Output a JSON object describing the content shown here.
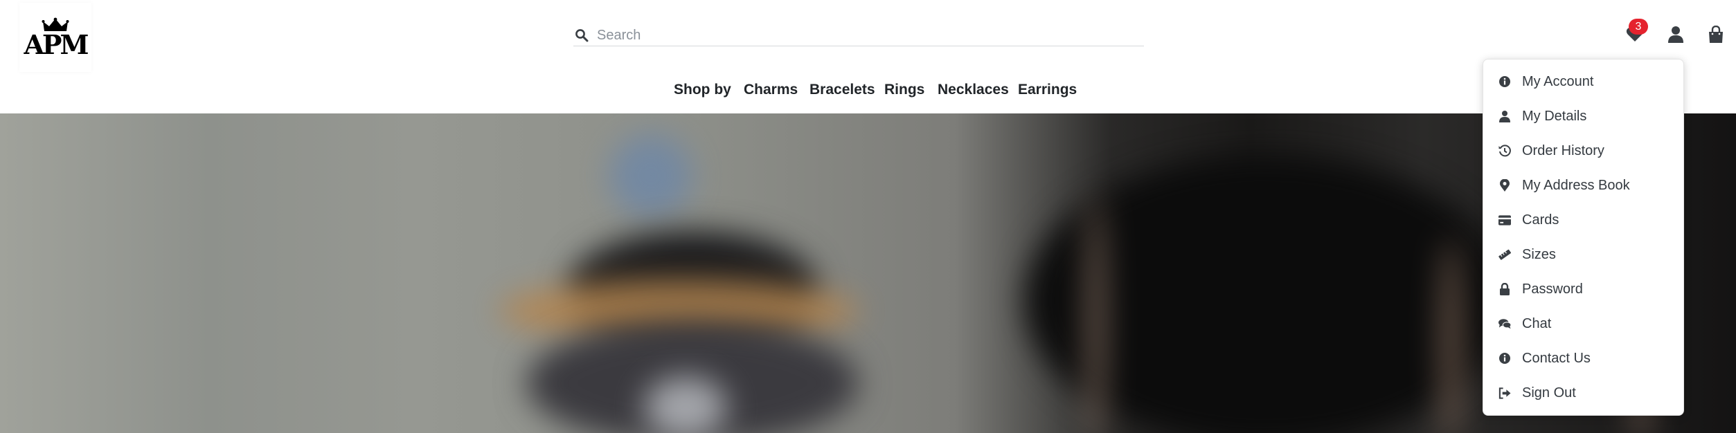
{
  "brand": {
    "logo_text": "APM"
  },
  "search": {
    "placeholder": "Search"
  },
  "header": {
    "wishlist_count": "3",
    "nav": [
      "Shop by",
      "Charms",
      "Bracelets",
      "Rings",
      "Necklaces",
      "Earrings"
    ]
  },
  "account_menu": {
    "items": [
      {
        "label": "My Account",
        "icon": "info-circle-icon"
      },
      {
        "label": "My Details",
        "icon": "user-icon"
      },
      {
        "label": "Order History",
        "icon": "history-icon"
      },
      {
        "label": "My Address Book",
        "icon": "map-pin-icon"
      },
      {
        "label": "Cards",
        "icon": "credit-card-icon"
      },
      {
        "label": "Sizes",
        "icon": "ruler-icon"
      },
      {
        "label": "Password",
        "icon": "lock-icon"
      },
      {
        "label": "Chat",
        "icon": "chat-icon"
      },
      {
        "label": "Contact Us",
        "icon": "info-circle-icon"
      },
      {
        "label": "Sign Out",
        "icon": "sign-out-icon"
      }
    ]
  },
  "colors": {
    "badge": "#e5232e",
    "icon": "#3a3f44",
    "text": "#212529"
  }
}
